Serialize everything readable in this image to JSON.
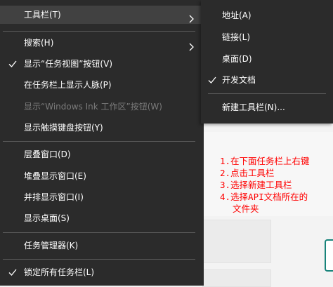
{
  "main_menu": {
    "items": [
      {
        "label": "工具栏(T)"
      },
      {
        "label": "搜索(H)"
      },
      {
        "label": "显示“任务视图”按钮(V)"
      },
      {
        "label": "在任务栏上显示人脉(P)"
      },
      {
        "label": "显示“Windows Ink 工作区”按钮(W)"
      },
      {
        "label": "显示触摸键盘按钮(Y)"
      },
      {
        "label": "层叠窗口(D)"
      },
      {
        "label": "堆叠显示窗口(E)"
      },
      {
        "label": "并排显示窗口(I)"
      },
      {
        "label": "显示桌面(S)"
      },
      {
        "label": "任务管理器(K)"
      },
      {
        "label": "锁定所有任务栏(L)"
      }
    ]
  },
  "toolbar_submenu": {
    "items": [
      {
        "label": "地址(A)"
      },
      {
        "label": "链接(L)"
      },
      {
        "label": "桌面(D)"
      },
      {
        "label": "开发文档"
      },
      {
        "label": "新建工具栏(N)..."
      }
    ]
  },
  "annotation": {
    "lines": [
      "1.在下面任务栏上右键",
      "2.点击工具栏",
      "3.选择新建工具栏",
      "4.选择API文档所在的",
      "文件夹"
    ],
    "color": "#ff0000"
  },
  "colors": {
    "menu_bg": "#2b2b2b",
    "highlight_bg": "#414141",
    "disabled_text": "#7a7a7a"
  }
}
